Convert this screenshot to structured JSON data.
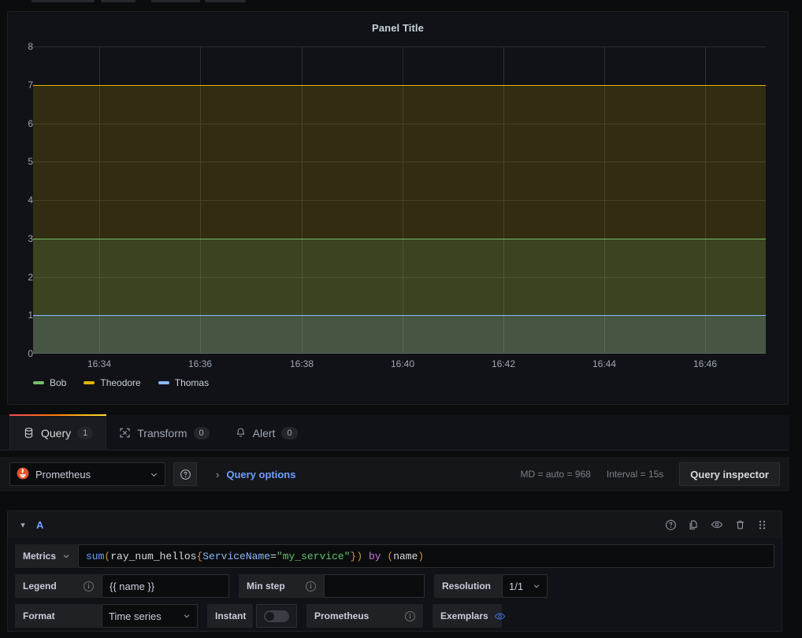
{
  "panel": {
    "title": "Panel Title"
  },
  "chart_data": {
    "type": "area",
    "title": "Panel Title",
    "xlabel": "",
    "ylabel": "",
    "ylim": [
      0,
      8
    ],
    "yticks": [
      0,
      1,
      2,
      3,
      4,
      5,
      6,
      7,
      8
    ],
    "xticks": [
      "16:34",
      "16:36",
      "16:38",
      "16:40",
      "16:42",
      "16:44",
      "16:46"
    ],
    "grid": true,
    "legend_position": "bottom",
    "stacked": false,
    "series": [
      {
        "name": "Bob",
        "color": "#73bf69",
        "constant_value": 3,
        "values": [
          3,
          3,
          3,
          3,
          3,
          3,
          3
        ]
      },
      {
        "name": "Theodore",
        "color": "#e0b400",
        "constant_value": 7,
        "values": [
          7,
          7,
          7,
          7,
          7,
          7,
          7
        ]
      },
      {
        "name": "Thomas",
        "color": "#8ab8ff",
        "constant_value": 1,
        "values": [
          1,
          1,
          1,
          1,
          1,
          1,
          1
        ]
      }
    ]
  },
  "tabs": [
    {
      "label": "Query",
      "count": "1",
      "icon": "database-icon",
      "active": true
    },
    {
      "label": "Transform",
      "count": "0",
      "icon": "transform-icon",
      "active": false
    },
    {
      "label": "Alert",
      "count": "0",
      "icon": "bell-icon",
      "active": false
    }
  ],
  "query_bar": {
    "datasource": "Prometheus",
    "datasource_icon": "prometheus-icon",
    "help_icon": "help-circle-icon",
    "expand_chevron": "chevron-right-icon",
    "query_options_label": "Query options",
    "meta_md": "MD = auto = 968",
    "meta_interval": "Interval = 15s",
    "query_inspector_label": "Query inspector"
  },
  "query_row": {
    "id": "A",
    "collapse_icon": "chevron-down-icon",
    "actions": [
      {
        "name": "help-circle-icon"
      },
      {
        "name": "duplicate-query-icon"
      },
      {
        "name": "toggle-visibility-eye-icon"
      },
      {
        "name": "delete-trash-icon"
      },
      {
        "name": "drag-handle-icon"
      }
    ],
    "metrics_label": "Metrics",
    "expr_tokens": [
      {
        "t": "sum",
        "c": "s-fn"
      },
      {
        "t": "(",
        "c": "s-paren"
      },
      {
        "t": "ray_num_hellos",
        "c": "s-metric"
      },
      {
        "t": "{",
        "c": "s-paren"
      },
      {
        "t": "ServiceName",
        "c": "s-label"
      },
      {
        "t": "=",
        "c": "s-op"
      },
      {
        "t": "\"my_service\"",
        "c": "s-str"
      },
      {
        "t": "}",
        "c": "s-paren"
      },
      {
        "t": ")",
        "c": "s-paren"
      },
      {
        "t": " ",
        "c": "s-op"
      },
      {
        "t": "by",
        "c": "s-kw"
      },
      {
        "t": " ",
        "c": "s-op"
      },
      {
        "t": "(",
        "c": "s-paren"
      },
      {
        "t": "name",
        "c": "s-metric"
      },
      {
        "t": ")",
        "c": "s-paren"
      }
    ],
    "expr_plain": "sum(ray_num_hellos{ServiceName=\"my_service\"}) by (name)",
    "legend_label": "Legend",
    "legend_value": "{{ name }}",
    "min_step_label": "Min step",
    "min_step_value": "",
    "resolution_label": "Resolution",
    "resolution_value": "1/1",
    "format_label": "Format",
    "format_value": "Time series",
    "instant_label": "Instant",
    "instant_on": false,
    "prometheus_label": "Prometheus",
    "exemplars_label": "Exemplars",
    "exemplars_icon": "eye-icon"
  }
}
